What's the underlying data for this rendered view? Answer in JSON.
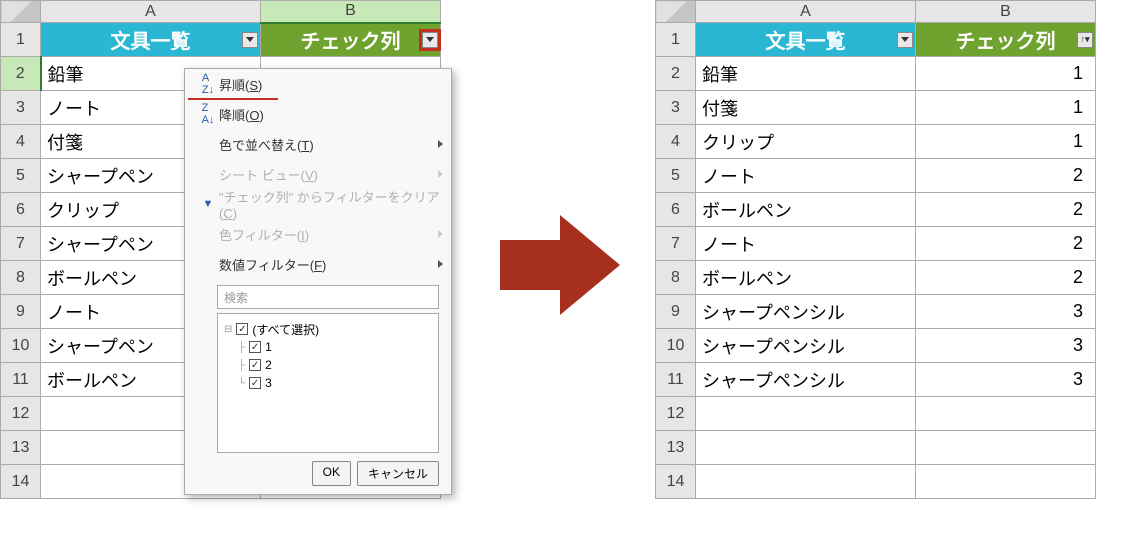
{
  "columns": {
    "A": "A",
    "B": "B"
  },
  "header": {
    "colA": "文具一覧",
    "colB": "チェック列"
  },
  "left_rows": [
    "鉛筆",
    "ノート",
    "付箋",
    "シャープペン",
    "クリップ",
    "シャープペン",
    "ボールペン",
    "ノート",
    "シャープペン",
    "ボールペン"
  ],
  "right_rows": [
    {
      "name": "鉛筆",
      "val": "1"
    },
    {
      "name": "付箋",
      "val": "1"
    },
    {
      "name": "クリップ",
      "val": "1"
    },
    {
      "name": "ノート",
      "val": "2"
    },
    {
      "name": "ボールペン",
      "val": "2"
    },
    {
      "name": "ノート",
      "val": "2"
    },
    {
      "name": "ボールペン",
      "val": "2"
    },
    {
      "name": "シャープペンシル",
      "val": "3"
    },
    {
      "name": "シャープペンシル",
      "val": "3"
    },
    {
      "name": "シャープペンシル",
      "val": "3"
    }
  ],
  "menu": {
    "sort_asc": "昇順",
    "sort_asc_key": "S",
    "sort_desc": "降順",
    "sort_desc_key": "O",
    "sort_color": "色で並べ替え",
    "sort_color_key": "T",
    "sheet_view": "シート ビュー",
    "sheet_view_key": "V",
    "clear_filter": "\"チェック列\" からフィルターをクリア",
    "clear_filter_key": "C",
    "color_filter": "色フィルター",
    "color_filter_key": "I",
    "num_filter": "数値フィルター",
    "num_filter_key": "F",
    "search_placeholder": "検索",
    "tree": {
      "all": "(すべて選択)",
      "items": [
        "1",
        "2",
        "3"
      ]
    },
    "ok": "OK",
    "cancel": "キャンセル"
  }
}
